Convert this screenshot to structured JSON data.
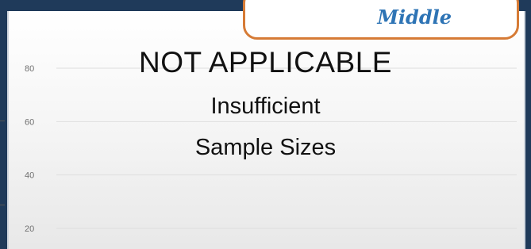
{
  "badge": {
    "label": "Middle",
    "border_color": "#d67b36",
    "text_color": "#2e74b5"
  },
  "chart_data": {
    "type": "bar",
    "categories": [],
    "series": [],
    "y_ticks": [
      20,
      40,
      60,
      80
    ],
    "ylim": [
      0,
      90
    ],
    "grid": true,
    "overlay": {
      "title": "NOT APPLICABLE",
      "line1": "Insufficient",
      "line2": "Sample Sizes"
    }
  }
}
